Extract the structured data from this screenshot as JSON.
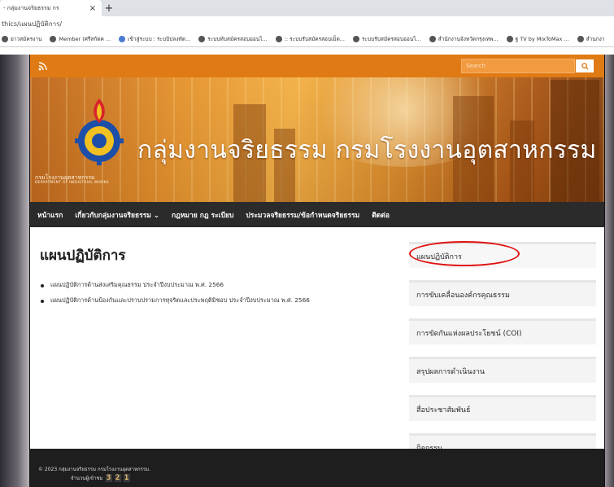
{
  "browser": {
    "tab_title": "- กลุ่มงานจริยธรรม กร",
    "new_tab": "+",
    "tab_close": "×",
    "url": "thics/แผนปฏิบัติการ/",
    "bookmarks": [
      {
        "label": "ยาวสมัครงาน",
        "icon": "globe-icon"
      },
      {
        "label": "Member (ศรีสกัดค ...",
        "icon": "globe-icon"
      },
      {
        "label": "เข้าสู่ระบบ : ระบบิปลงทัด...",
        "icon": "globe-icon"
      },
      {
        "label": "ระบบทับสมัครสอบออนไ...",
        "icon": "globe-icon"
      },
      {
        "label": ":: ระบบรับสมัครสอบเม็ด...",
        "icon": "globe-icon"
      },
      {
        "label": "ระบบรับสมัครสอบออนไ...",
        "icon": "globe-icon"
      },
      {
        "label": "สำนักงานจังหวัดกรุงเทพ...",
        "icon": "globe-icon"
      },
      {
        "label": "ฐ TV by MixToMax ...",
        "icon": "tv-icon"
      },
      {
        "label": "สำนกงา",
        "icon": "globe-icon"
      }
    ]
  },
  "header": {
    "search_placeholder": "Search",
    "site_title": "กลุ่มงานจริยธรรม กรมโรงงานอุตสาหกรรม",
    "logo_text": "กรมโรงงานอุตสาหกรรม",
    "logo_subtext": "DEPARTMENT OF INDUSTRIAL WORKS",
    "accent_color": "#e07a14"
  },
  "nav": {
    "items": [
      {
        "label": "หน้าแรก"
      },
      {
        "label": "เกี่ยวกับกลุ่มงานจริยธรรม ⌄"
      },
      {
        "label": "กฎหมาย กฎ ระเบียบ"
      },
      {
        "label": "ประมวลจริยธรรม/ข้อกำหนดจริยธรรม"
      },
      {
        "label": "ติดต่อ"
      }
    ]
  },
  "main": {
    "title": "แผนปฏิบัติการ",
    "items": [
      "แผนปฏิบัติการด้านส่งเสริมคุณธรรม ประจำปีงบประมาณ พ.ศ. 2566",
      "แผนปฏิบัติการด้านป้องกันและปราบปรามการทุจริตและประพฤติมิชอบ ประจำปีงบประมาณ พ.ศ. 2566"
    ]
  },
  "sidebar": {
    "items": [
      "แผนปฏิบัติการ",
      "การขับเคลื่อนองค์กรคุณธรรม",
      "การขัดกันแห่งผลประโยชน์ (COI)",
      "สรุปผลการดำเนินงาน",
      "สื่อประชาสัมพันธ์",
      "กิจกรรม"
    ],
    "highlight_color": "#e01010"
  },
  "footer": {
    "copyright": "© 2023 กลุ่มงานจริยธรรม กรมโรงงานอุตสาหกรรม.",
    "visitor_label": "จำนวนผู้เข้าชม",
    "counter": [
      "3",
      "2",
      "1"
    ]
  }
}
